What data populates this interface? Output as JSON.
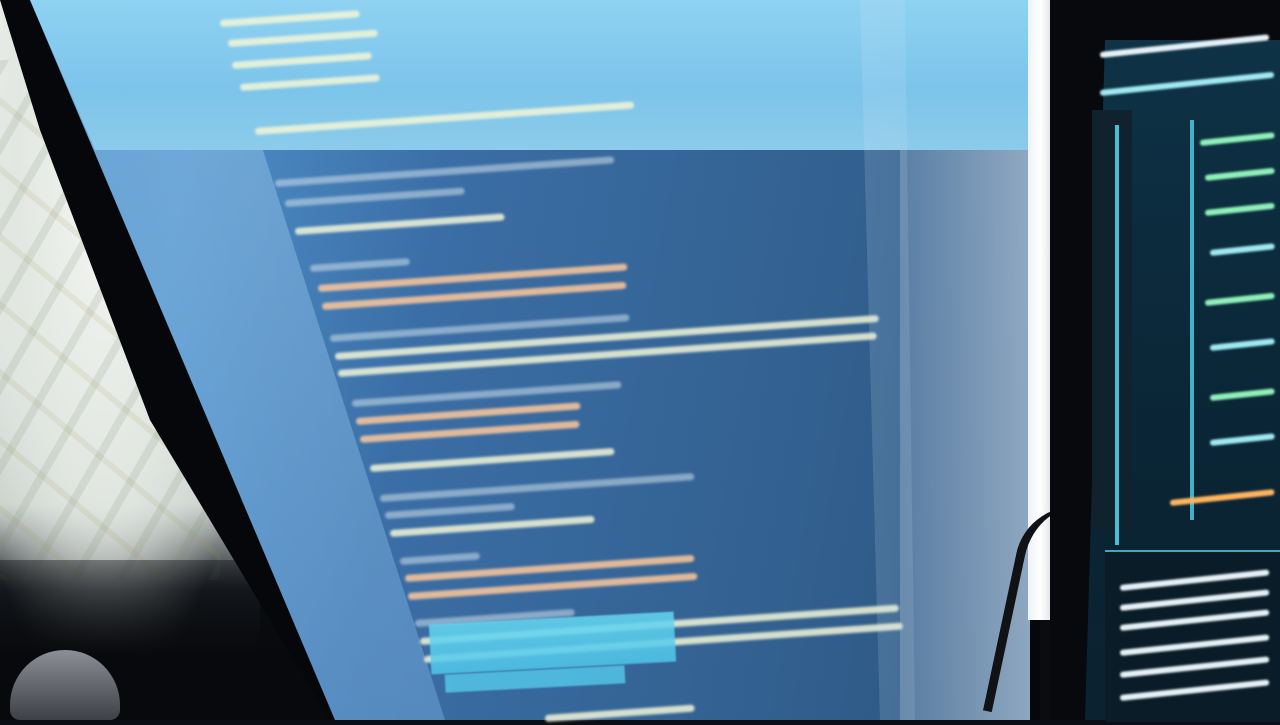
{
  "scene": {
    "kind": "photo-of-monitors",
    "colors": {
      "screen_blue": "#3b6ea6",
      "glare": "#8fd2f2",
      "code_text": "#f3f6d8",
      "selection": "#66d8f2",
      "right_screen_bg": "#0e3246",
      "right_accent": "#4fd0e6"
    },
    "elements": {
      "main_monitor": "main-monitor",
      "code_editor": "blurred-code-editor",
      "secondary_monitor": "secondary-monitor",
      "fabric": "fabric-curtain",
      "mouse": "mouse"
    }
  }
}
